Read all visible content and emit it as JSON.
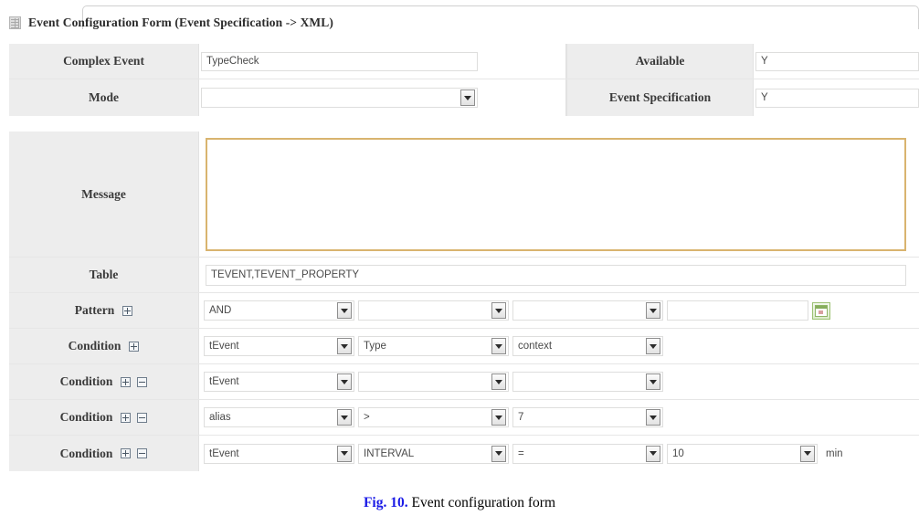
{
  "window": {
    "title": "Event Configuration Form (Event Specification ->  XML)",
    "icon": "grid-icon"
  },
  "top_section": {
    "rows": [
      {
        "left_label": "Complex Event",
        "left_value": "TypeCheck",
        "right_label": "Available",
        "right_value": "Y"
      },
      {
        "left_label": "Mode",
        "left_value": "",
        "right_label": "Event Specification",
        "right_value": "Y"
      }
    ]
  },
  "main_section": {
    "message": {
      "label": "Message",
      "value": ""
    },
    "table": {
      "label": "Table",
      "value": "TEVENT,TEVENT_PROPERTY"
    },
    "pattern": {
      "label": "Pattern",
      "add_icon": "plus-box-icon",
      "selects": [
        "AND",
        "",
        ""
      ],
      "text_value": "",
      "browse_icon": "green-window-icon"
    },
    "conditions": [
      {
        "label": "Condition",
        "add_icon": "plus-box-icon",
        "remove_icon": null,
        "selects": [
          "tEvent",
          "Type",
          "context"
        ]
      },
      {
        "label": "Condition",
        "add_icon": "plus-box-icon",
        "remove_icon": "minus-box-icon",
        "selects": [
          "tEvent",
          "",
          ""
        ]
      },
      {
        "label": "Condition",
        "add_icon": "plus-box-icon",
        "remove_icon": "minus-box-icon",
        "selects": [
          "alias",
          ">",
          "7"
        ]
      },
      {
        "label": "Condition",
        "add_icon": "plus-box-icon",
        "remove_icon": "minus-box-icon",
        "selects": [
          "tEvent",
          "INTERVAL",
          "=",
          "10"
        ],
        "trailing_text": "min"
      }
    ]
  },
  "caption": {
    "figure": "Fig. 10.",
    "text": " Event configuration form"
  },
  "colors": {
    "label_bg": "#ededed",
    "textarea_border": "#d9b46f",
    "caption_accent": "#1a1ae6",
    "green_icon": "#8fb567"
  }
}
